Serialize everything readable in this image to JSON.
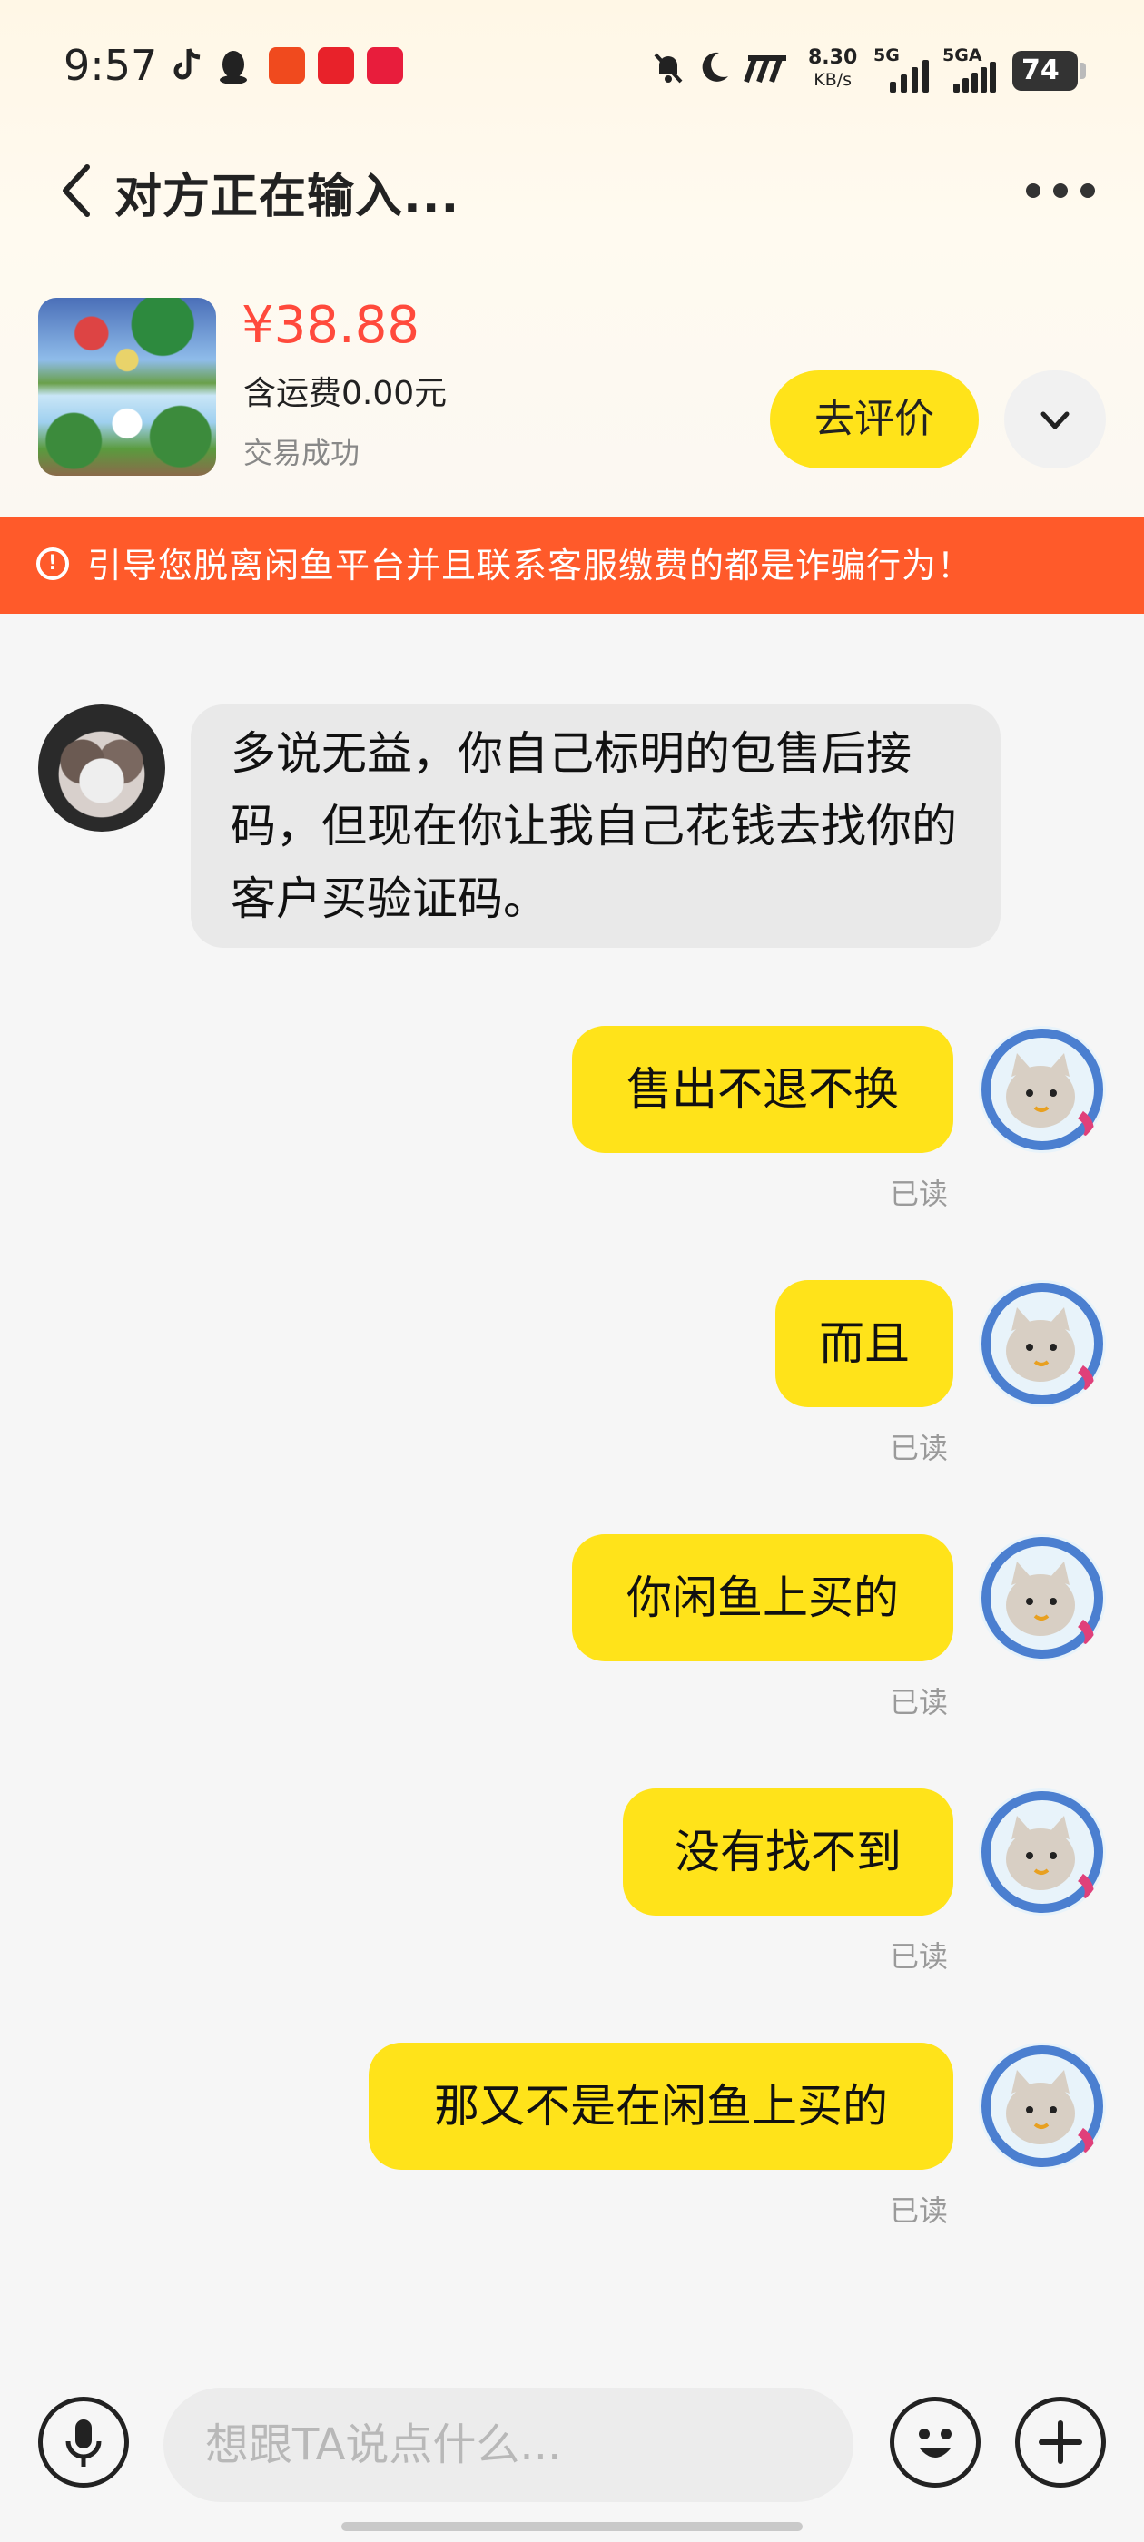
{
  "status_bar": {
    "time": "9:57",
    "net_speed": "8.30",
    "net_unit": "KB/s",
    "sig1": "5G",
    "sig2": "5GA",
    "battery": "74",
    "app_icons": [
      "tiktok-icon",
      "qq-icon",
      "listen-app-icon",
      "g-app-icon",
      "red-app-icon"
    ],
    "status_icons": [
      "mute-bell-icon",
      "moon-icon",
      "mi-icon"
    ]
  },
  "header": {
    "title": "对方正在输入..."
  },
  "product": {
    "price": "¥38.88",
    "shipping": "含运费0.00元",
    "state": "交易成功",
    "rate_label": "去评价"
  },
  "warning": {
    "text": "引导您脱离闲鱼平台并且联系客服缴费的都是诈骗行为！",
    "icon_glyph": "!"
  },
  "messages": [
    {
      "from": "other",
      "text": "多说无益，你自己标明的包售后接码，但现在你让我自己花钱去找你的客户买验证码。"
    },
    {
      "from": "me",
      "text": "售出不退不换",
      "status": "已读"
    },
    {
      "from": "me",
      "text": "而且",
      "status": "已读"
    },
    {
      "from": "me",
      "text": "你闲鱼上买的",
      "status": "已读"
    },
    {
      "from": "me",
      "text": "没有找不到",
      "status": "已读"
    },
    {
      "from": "me",
      "text": "那又不是在闲鱼上买的",
      "status": "已读"
    }
  ],
  "input": {
    "placeholder": "想跟TA说点什么..."
  },
  "colors": {
    "accent_yellow": "#ffe31a",
    "warning_orange": "#ff5a2a",
    "price_red": "#ff4a3c",
    "incoming_bubble": "#e9e9e9"
  }
}
